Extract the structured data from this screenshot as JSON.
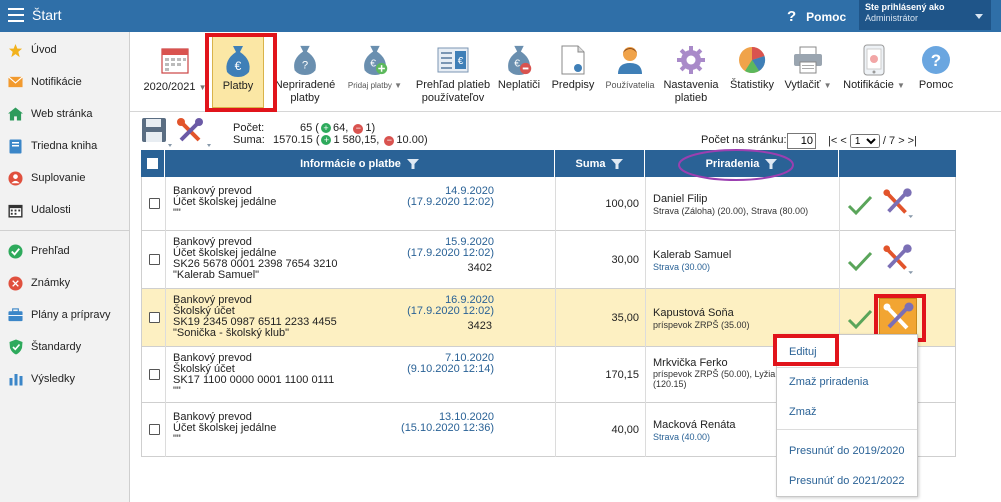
{
  "header": {
    "title": "Štart",
    "help_label": "Pomoc",
    "user_line1": "Ste prihlásený ako",
    "user_line2": "Administrátor"
  },
  "sidebar": {
    "items": [
      {
        "label": "Úvod",
        "icon": "star-icon"
      },
      {
        "label": "Notifikácie",
        "icon": "envelope-icon"
      },
      {
        "label": "Web stránka",
        "icon": "home-icon"
      },
      {
        "label": "Triedna kniha",
        "icon": "book-icon"
      },
      {
        "label": "Suplovanie",
        "icon": "substitute-icon"
      },
      {
        "label": "Udalosti",
        "icon": "calendar-icon"
      },
      {
        "label": "Prehľad",
        "icon": "check-circle-icon"
      },
      {
        "label": "Známky",
        "icon": "grades-icon"
      },
      {
        "label": "Plány a prípravy",
        "icon": "briefcase-icon"
      },
      {
        "label": "Štandardy",
        "icon": "shield-icon"
      },
      {
        "label": "Výsledky",
        "icon": "bar-chart-icon"
      }
    ]
  },
  "toolbar": {
    "year": "2020/2021",
    "platby": "Platby",
    "nepriradene_1": "Nepriradené",
    "nepriradene_2": "platby",
    "pridaj": "Pridaj platby",
    "prehlad_1": "Prehľad platieb",
    "prehlad_2": "používateľov",
    "neplatici": "Neplatiči",
    "predpisy": "Predpisy",
    "pouzivatelia": "Používatelia",
    "nastavenia_1": "Nastavenia",
    "nastavenia_2": "platieb",
    "statistiky": "Štatistiky",
    "vytlacit": "Vytlačiť",
    "notifikacie": "Notifikácie",
    "pomoc": "Pomoc"
  },
  "summary": {
    "count_label": "Počet:",
    "count_value": "65 (",
    "count_plus": "64,",
    "count_minus": "1)",
    "sum_label": "Suma:",
    "sum_value": "1570.15 (",
    "sum_plus": "1 580,15,",
    "sum_minus": "10.00)"
  },
  "pagination": {
    "per_page_label": "Počet na stránku:",
    "per_page_value": "10",
    "prev": "|< <",
    "page": "1",
    "total": "/ 7",
    "next": "> >|"
  },
  "table": {
    "headers": {
      "info": "Informácie o platbe",
      "sum": "Suma",
      "assign": "Priradenia"
    },
    "rows": [
      {
        "type": "Bankový prevod",
        "account": "Účet školskej jedálne",
        "iban": "",
        "note": "\"\"",
        "date": "14.9.2020",
        "date2": "(17.9.2020 12:02)",
        "vs": "",
        "sum": "100,00",
        "name": "Daniel Filip",
        "sub": "Strava (Záloha) (20.00), Strava (80.00)",
        "sub_color": "#333333"
      },
      {
        "type": "Bankový prevod",
        "account": "Účet školskej jedálne",
        "iban": "SK26 5678 0001 2398 7654 3210",
        "note": "\"Kalerab Samuel\"",
        "date": "15.9.2020",
        "date2": "(17.9.2020 12:02)",
        "vs": "3402",
        "sum": "30,00",
        "name": "Kalerab Samuel",
        "sub": "Strava (30.00)",
        "sub_color": "#2a6296"
      },
      {
        "type": "Bankový prevod",
        "account": "Školský účet",
        "iban": "SK19 2345 0987 6511 2233 4455",
        "note": "\"Sonička - školský klub\"",
        "date": "16.9.2020",
        "date2": "(17.9.2020 12:02)",
        "vs": "3423",
        "sum": "35,00",
        "name": "Kapustová Soňa",
        "sub": "príspevok ZRPŠ (35.00)",
        "sub_color": "#333333"
      },
      {
        "type": "Bankový prevod",
        "account": "Školský účet",
        "iban": "SK17 1100 0000 0001 1100 0111",
        "note": "\"\"",
        "date": "7.10.2020",
        "date2": "(9.10.2020 12:14)",
        "vs": "",
        "sum": "170,15",
        "name": "Mrkvička Ferko",
        "sub": "príspevok ZRPŠ (50.00), Lyžia",
        "sub2": "(120.15)",
        "sub_color": "#333333"
      },
      {
        "type": "Bankový prevod",
        "account": "Účet školskej jedálne",
        "iban": "",
        "note": "\"\"",
        "date": "13.10.2020",
        "date2": "(15.10.2020 12:36)",
        "vs": "",
        "sum": "40,00",
        "name": "Macková Renáta",
        "sub": "Strava (40.00)",
        "sub_color": "#2a6296"
      }
    ]
  },
  "context_menu": {
    "edit": "Edituj",
    "delete_assign": "Zmaž priradenia",
    "delete": "Zmaž",
    "move_prev": "Presunúť do 2019/2020",
    "move_next": "Presunúť do 2021/2022"
  },
  "colors": {
    "header_blue": "#2f6fa8",
    "table_header": "#2a6296",
    "highlight_row": "#fdf0c2",
    "annotation_red": "#e1141b",
    "annotation_purple": "#9b3fb0"
  }
}
